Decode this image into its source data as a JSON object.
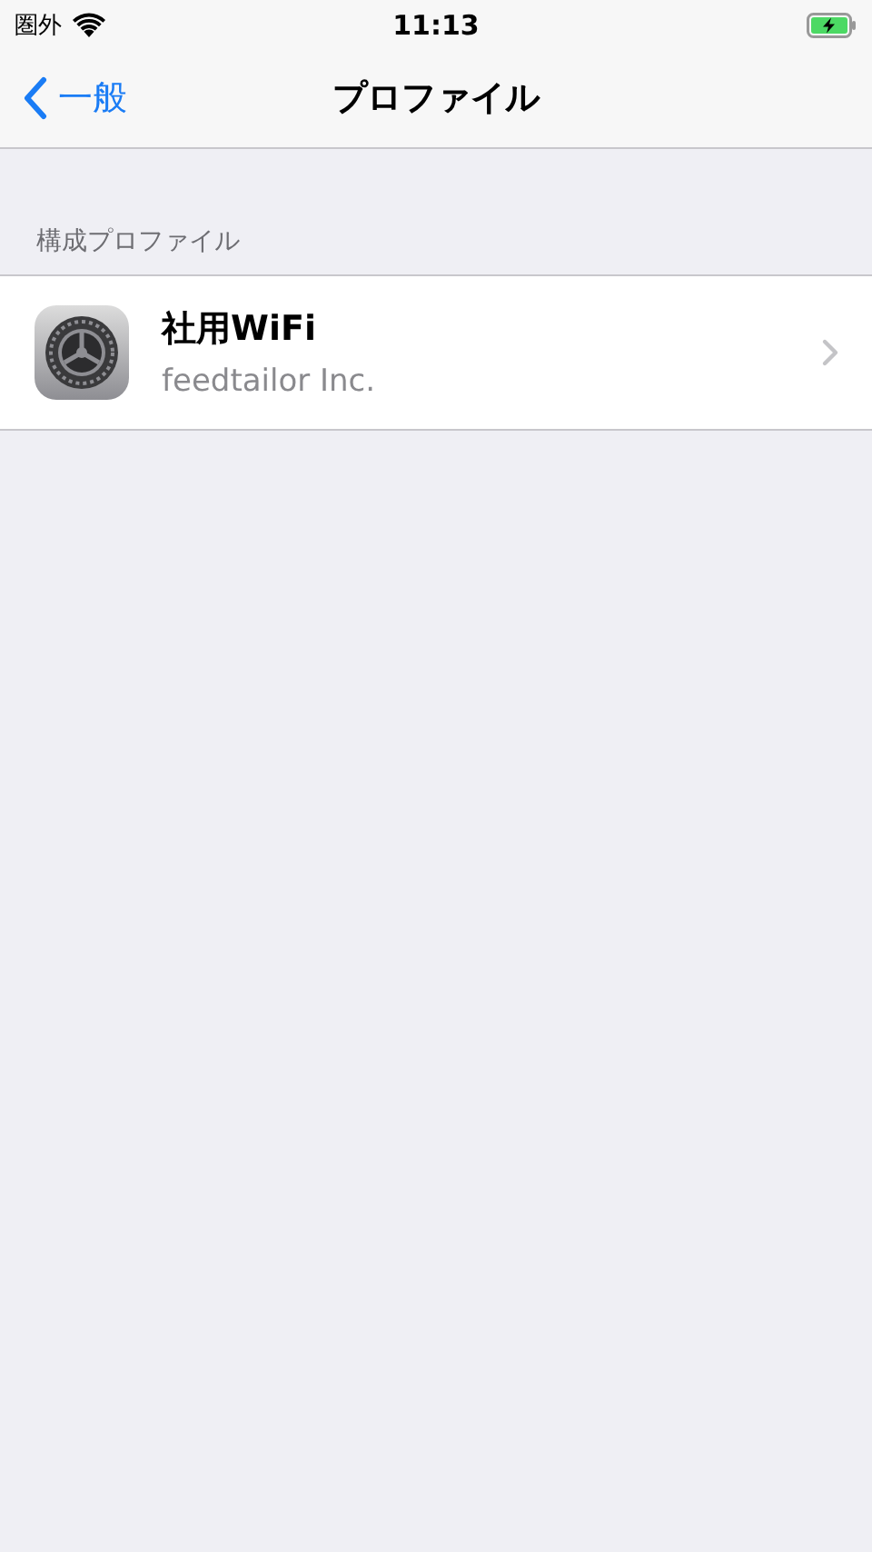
{
  "status_bar": {
    "carrier": "圏外",
    "time": "11:13",
    "battery_charging": true
  },
  "nav": {
    "back": "一般",
    "title": "プロファイル"
  },
  "section": {
    "header": "構成プロファイル",
    "items": [
      {
        "name": "社用WiFi",
        "organization": "feedtailor Inc."
      }
    ]
  }
}
